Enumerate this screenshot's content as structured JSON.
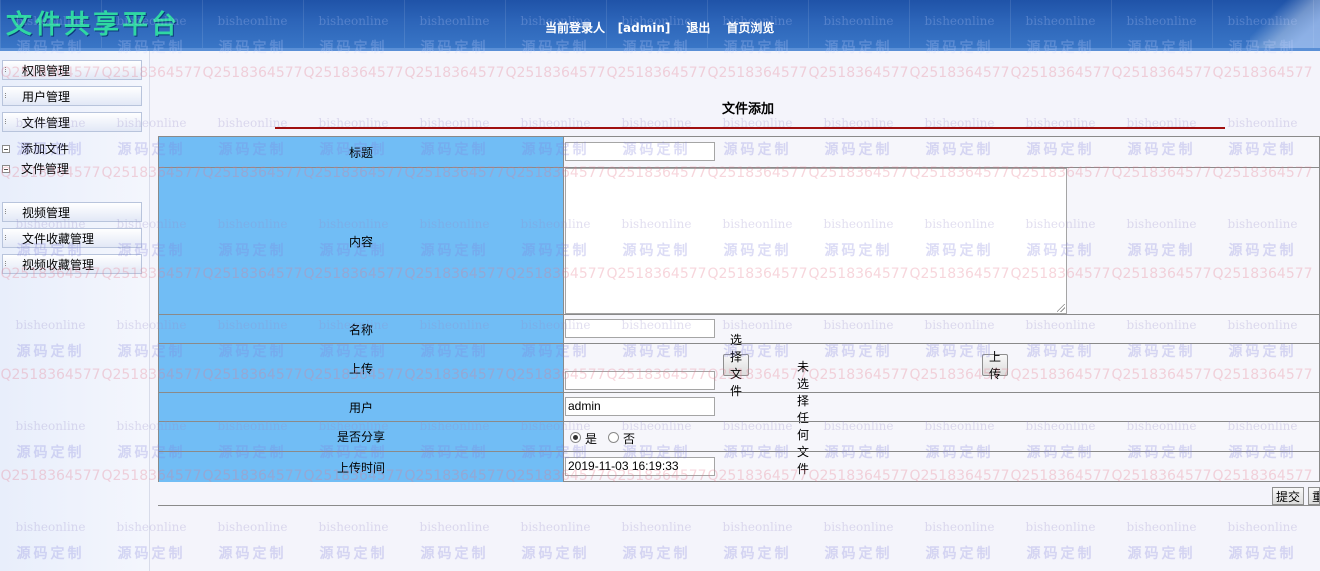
{
  "header": {
    "logo": "文件共享平台",
    "current_user_label": "当前登录人",
    "current_user": "[admin]",
    "logout": "退出",
    "home_browse": "首页浏览"
  },
  "watermark": {
    "text_a": "bisheonline",
    "text_b": "源码定制",
    "text_c": "Q2518364577"
  },
  "sidebar": {
    "items": [
      {
        "label": "权限管理"
      },
      {
        "label": "用户管理"
      },
      {
        "label": "文件管理"
      }
    ],
    "sub_items": [
      {
        "label": "添加文件"
      },
      {
        "label": "文件管理"
      }
    ],
    "more_items": [
      {
        "label": "视频管理"
      },
      {
        "label": "文件收藏管理"
      },
      {
        "label": "视频收藏管理"
      }
    ]
  },
  "form": {
    "title": "文件添加",
    "fields": {
      "title_label": "标题",
      "title_value": "",
      "content_label": "内容",
      "name_label": "名称",
      "name_value": "",
      "upload_label": "上传",
      "choose_file": "选择文件",
      "no_file": "未选择任何文件",
      "upload_button": "上传",
      "user_label": "用户",
      "user_value": "admin",
      "share_label": "是否分享",
      "share_yes": "是",
      "share_no": "否",
      "share_selected": "是",
      "time_label": "上传时间",
      "time_value": "2019-11-03 16:19:33"
    },
    "submit": "提交",
    "reset": "重"
  }
}
